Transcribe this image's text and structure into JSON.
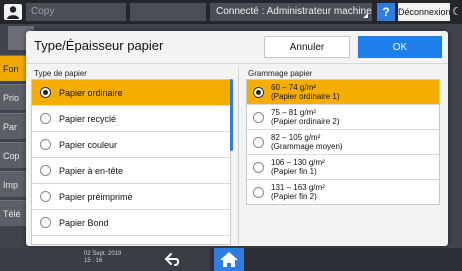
{
  "topbar": {
    "app": "Copy",
    "status": "Connecté : Administrateur machine",
    "help": "?",
    "logout": "Déconnexion",
    "moon_glyph": "☾"
  },
  "background_tabs": [
    {
      "label": "Fon",
      "active": true
    },
    {
      "label": "Prio",
      "active": false
    },
    {
      "label": "Par",
      "active": false
    },
    {
      "label": "Cop",
      "active": false
    },
    {
      "label": "Imp",
      "active": false
    },
    {
      "label": "Télé",
      "active": false
    }
  ],
  "dialog": {
    "title": "Type/Épaisseur papier",
    "cancel_label": "Annuler",
    "ok_label": "OK",
    "paper_type_header": "Type de papier",
    "paper_weight_header": "Grammage papier",
    "paper_types": [
      {
        "label": "Papier ordinaire",
        "selected": true
      },
      {
        "label": "Papier recyclé",
        "selected": false
      },
      {
        "label": "Papier couleur",
        "selected": false
      },
      {
        "label": "Papier à en-tête",
        "selected": false
      },
      {
        "label": "Papier préimprimé",
        "selected": false
      },
      {
        "label": "Papier Bond",
        "selected": false
      }
    ],
    "paper_weights": [
      {
        "range": "60 – 74 g/m²",
        "name": "(Papier ordinaire 1)",
        "selected": true
      },
      {
        "range": "75 – 81 g/m²",
        "name": "(Papier ordinaire 2)",
        "selected": false
      },
      {
        "range": "82 – 105 g/m²",
        "name": "(Grammage moyen)",
        "selected": false
      },
      {
        "range": "106 – 130 g/m²",
        "name": "(Papier fin 1)",
        "selected": false
      },
      {
        "range": "131 – 163 g/m²",
        "name": "(Papier fin 2)",
        "selected": false
      }
    ]
  },
  "bottombar": {
    "date": "02 Sept. 2019",
    "time": "15 : 16"
  },
  "colors": {
    "accent_blue": "#1f80ec",
    "selected_orange": "#f5ae00"
  }
}
